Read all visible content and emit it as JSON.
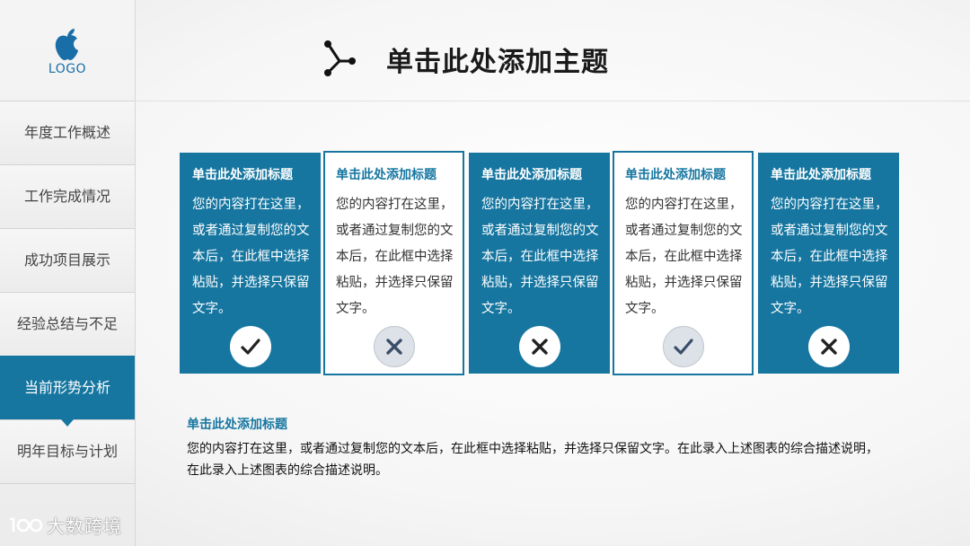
{
  "sidebar": {
    "logo_text": "LOGO",
    "items": [
      {
        "label": "年度工作概述"
      },
      {
        "label": "工作完成情况"
      },
      {
        "label": "成功项目展示"
      },
      {
        "label": "经验总结与不足"
      },
      {
        "label": "当前形势分析",
        "active": true
      },
      {
        "label": "明年目标与计划"
      }
    ],
    "watermark": "大数跨境"
  },
  "header": {
    "title": "单击此处添加主题",
    "icon": "share-node-icon"
  },
  "cards": [
    {
      "title": "单击此处添加标题",
      "body": "您的内容打在这里，或者通过复制您的文本后，在此框中选择粘贴，并选择只保留文字。",
      "style": "filled",
      "mark": "check-icon"
    },
    {
      "title": "单击此处添加标题",
      "body": "您的内容打在这里，或者通过复制您的文本后，在此框中选择粘贴，并选择只保留文字。",
      "style": "outline",
      "mark": "cross-icon"
    },
    {
      "title": "单击此处添加标题",
      "body": "您的内容打在这里，或者通过复制您的文本后，在此框中选择粘贴，并选择只保留文字。",
      "style": "filled",
      "mark": "cross-icon"
    },
    {
      "title": "单击此处添加标题",
      "body": "您的内容打在这里，或者通过复制您的文本后，在此框中选择粘贴，并选择只保留文字。",
      "style": "outline",
      "mark": "check-icon"
    },
    {
      "title": "单击此处添加标题",
      "body": "您的内容打在这里，或者通过复制您的文本后，在此框中选择粘贴，并选择只保留文字。",
      "style": "filled",
      "mark": "cross-icon"
    }
  ],
  "description": {
    "title": "单击此处添加标题",
    "body": "您的内容打在这里，或者通过复制您的文本后，在此框中选择粘贴，并选择只保留文字。在此录入上述图表的综合描述说明，在此录入上述图表的综合描述说明。"
  },
  "colors": {
    "accent": "#1676a0",
    "sidebar_bg": "#efefef",
    "text_dark": "#1a1a1a"
  }
}
